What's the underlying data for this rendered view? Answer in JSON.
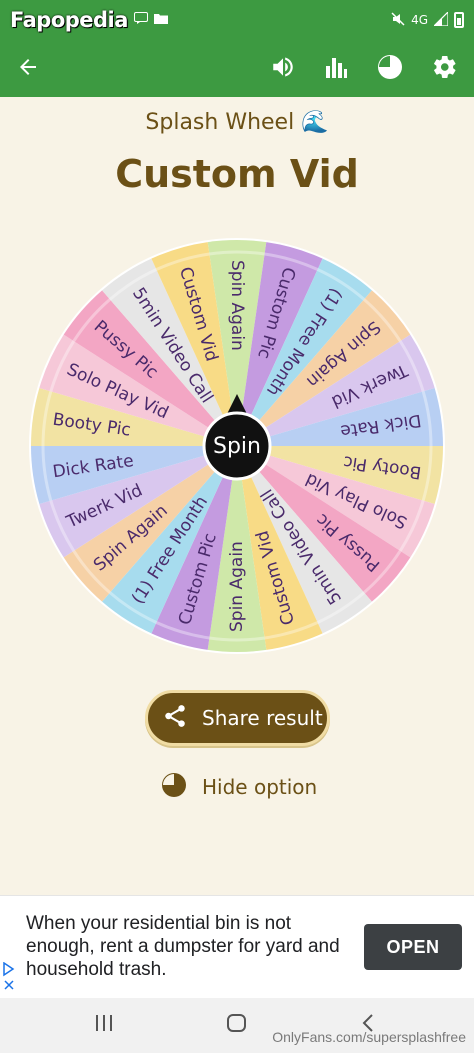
{
  "status_bar": {
    "watermark": "Fapopedia",
    "network": "4G"
  },
  "app_bar": {
    "back_icon": "arrow-left-icon",
    "icons": [
      "volume-icon",
      "bar-chart-icon",
      "pie-chart-icon",
      "gear-icon"
    ]
  },
  "main": {
    "subtitle": "Splash Wheel 🌊",
    "title": "Custom Vid",
    "spin_label": "Spin",
    "share_label": "Share result",
    "hide_label": "Hide option"
  },
  "wheel": {
    "segments": [
      {
        "label": "Spin Again",
        "color": "#cfe8a9"
      },
      {
        "label": "Custom Pic",
        "color": "#c49be0"
      },
      {
        "label": "(1) Free Month",
        "color": "#a7dcee"
      },
      {
        "label": "Spin Again",
        "color": "#f6d1a6"
      },
      {
        "label": "Twerk Vid",
        "color": "#d9c7ee"
      },
      {
        "label": "Dick Rate",
        "color": "#b8cff3"
      },
      {
        "label": "Booty Pic",
        "color": "#f2e3a3"
      },
      {
        "label": "Solo Play Vid",
        "color": "#f6c8d8"
      },
      {
        "label": "Pussy Pic",
        "color": "#f3a6c4"
      },
      {
        "label": "5min Video Call",
        "color": "#e6e6e6"
      },
      {
        "label": "Custom Vid",
        "color": "#f8db86"
      },
      {
        "label": "Spin Again",
        "color": "#cfe8a9"
      },
      {
        "label": "Custom Pic",
        "color": "#c49be0"
      },
      {
        "label": "(1) Free Month",
        "color": "#a7dcee"
      },
      {
        "label": "Spin Again",
        "color": "#f6d1a6"
      },
      {
        "label": "Twerk Vid",
        "color": "#d9c7ee"
      },
      {
        "label": "Dick Rate",
        "color": "#b8cff3"
      },
      {
        "label": "Booty Pic",
        "color": "#f2e3a3"
      },
      {
        "label": "Solo Play Vid",
        "color": "#f6c8d8"
      },
      {
        "label": "Pussy Pic",
        "color": "#f3a6c4"
      },
      {
        "label": "5min Video Call",
        "color": "#e6e6e6"
      },
      {
        "label": "Custom Vid",
        "color": "#f8db86"
      }
    ],
    "text_color": "#4a2a6b"
  },
  "ad": {
    "text": "When your residential bin is not enough, rent a dumpster for yard and household trash.",
    "button": "OPEN"
  },
  "nav_bar": {
    "watermark": "OnlyFans.com/supersplashfree"
  },
  "colors": {
    "green": "#3d9a41",
    "brown": "#6b5016",
    "background": "#f8f3e6"
  }
}
